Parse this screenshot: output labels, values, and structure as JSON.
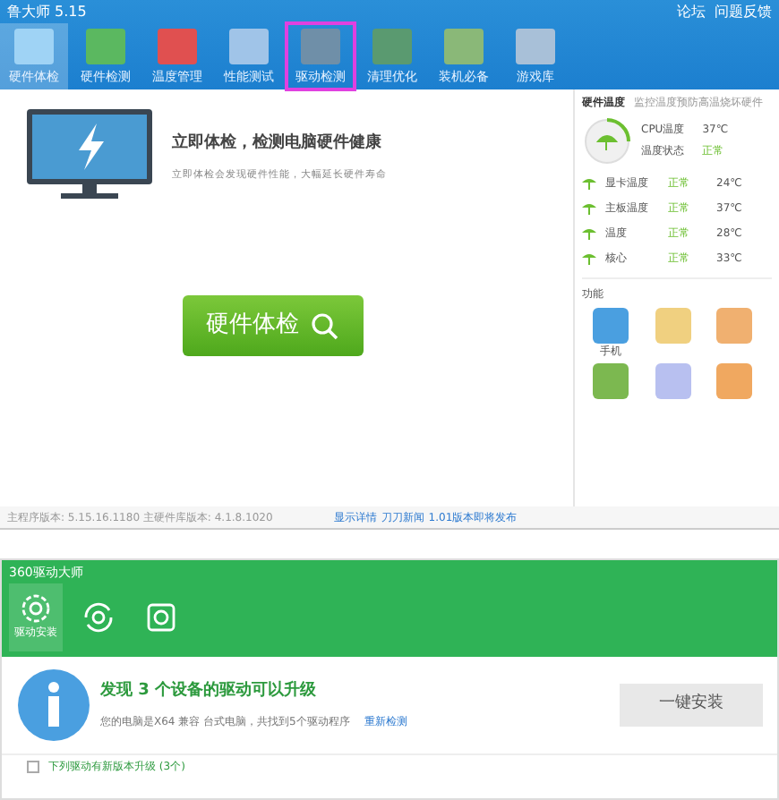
{
  "app_window": {
    "title": "鲁大师 5.15",
    "top_links": [
      "论坛",
      "问题反馈"
    ],
    "tabs": [
      {
        "label": "硬件体检",
        "selected": true
      },
      {
        "label": "硬件检测",
        "selected": false
      },
      {
        "label": "温度管理",
        "selected": false
      },
      {
        "label": "性能测试",
        "selected": false
      },
      {
        "label": "驱动检测",
        "selected": false,
        "highlighted": true
      },
      {
        "label": "清理优化",
        "selected": false
      },
      {
        "label": "装机必备",
        "selected": false
      },
      {
        "label": "游戏库",
        "selected": false
      }
    ],
    "main": {
      "heading": "立即体检，检测电脑硬件健康",
      "subtitle": "立即体检会发现硬件性能，大幅延长硬件寿命",
      "button": "硬件体检"
    },
    "temperature": {
      "title": "硬件温度",
      "hint": "监控温度预防高温烧坏硬件",
      "cpu": [
        {
          "label": "CPU温度",
          "value": "37℃"
        },
        {
          "label": "温度状态",
          "value": "正常"
        }
      ],
      "rows": [
        {
          "label": "显卡温度",
          "status": "正常",
          "value": "24℃"
        },
        {
          "label": "主板温度",
          "status": "正常",
          "value": "37℃"
        },
        {
          "label": "温度",
          "status": "正常",
          "value": "28℃"
        },
        {
          "label": "核心",
          "status": "正常",
          "value": "33℃"
        }
      ]
    },
    "functions": {
      "title": "功能",
      "items": [
        {
          "kind": "tile",
          "label": "手机"
        },
        {
          "kind": "tile"
        },
        {
          "kind": "tile"
        },
        {
          "kind": "tile"
        },
        {
          "kind": "tile"
        },
        {
          "kind": "tile"
        }
      ]
    },
    "status_bar": {
      "version": "主程序版本: 5.15.16.1180  主硬件库版本: 4.1.8.1020",
      "links": [
        "显示详情",
        "刀刀新闻",
        "1.01版本即将发布"
      ]
    }
  },
  "driver_window": {
    "title": "360驱动大师",
    "tools": [
      {
        "kind": "gear",
        "label": "驱动安装",
        "selected": true
      },
      {
        "kind": "refresh",
        "selected": false
      },
      {
        "kind": "disk",
        "selected": false
      }
    ],
    "heading": "发现 3 个设备的驱动可以升级",
    "detail": "您的电脑是X64 兼容 台式电脑，共找到5个驱动程序",
    "recheck": "重新检测",
    "install_button": "一键安装",
    "list_header": {
      "label": "下列驱动有新版本升级 (3个)",
      "checked": false
    }
  }
}
